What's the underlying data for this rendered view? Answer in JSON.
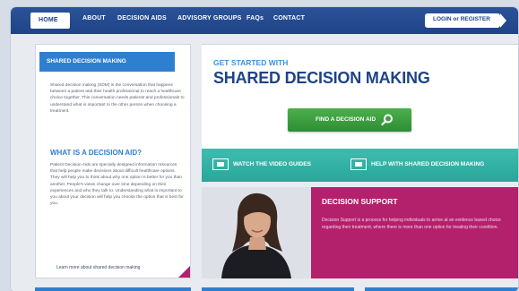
{
  "nav": {
    "items": [
      "HOME",
      "ABOUT",
      "DECISION AIDS",
      "ADVISORY GROUPS",
      "FAQs",
      "CONTACT"
    ],
    "login": "LOGIN or REGISTER"
  },
  "left": {
    "tab_label": "SHARED DECISION MAKING",
    "sdm_paragraph": "Shared decision making (SDM) is the conversation that happens between a patient and their health professional to reach a healthcare choice together. This conversation needs patients and professionals to understand what is important to the other person when choosing a treatment.",
    "subhead": "WHAT IS A DECISION AID?",
    "aid_paragraph": "Patient Decision Aids are specially designed information resources that help people make decisions about difficult healthcare options. They will help you to think about why one option is better for you than another. People's views change over time depending on their experiences and who they talk to. Understanding what is important to you about your decision will help you choose the option that is best for you.",
    "learn_more": "Learn more about shared decision making"
  },
  "main": {
    "get_started": "GET STARTED WITH",
    "title": "SHARED DECISION MAKING",
    "find_button": "FIND A DECISION AID",
    "video_guides": "WATCH THE VIDEO GUIDES",
    "help_link": "HELP WITH SHARED DECISION MAKING"
  },
  "support": {
    "title": "DECISION SUPPORT",
    "text": "Decision Support is a process for helping individuals to arrive at an evidence based choice regarding their treatment, where there is more than one option for treating their condition."
  },
  "colors": {
    "nav_blue": "#1f4387",
    "accent_blue": "#2f7fd0",
    "green": "#2f8d34",
    "teal": "#2aa69a",
    "magenta": "#b3206c"
  }
}
